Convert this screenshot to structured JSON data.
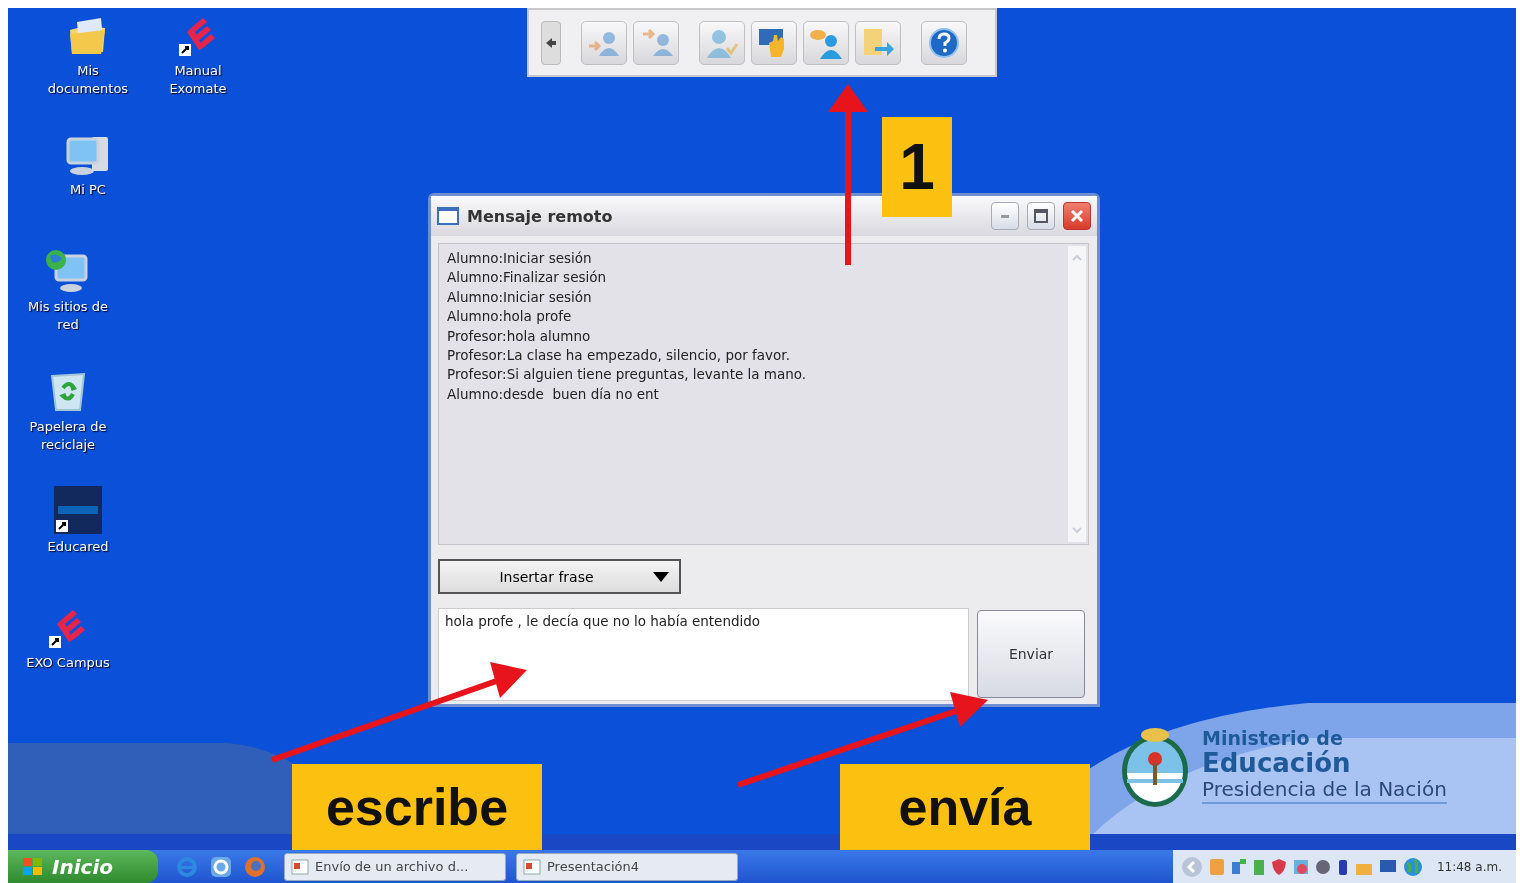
{
  "desktop_icons": [
    {
      "kind": "folder",
      "label": "Mis documentos"
    },
    {
      "kind": "exo",
      "label": "Manual Exomate"
    },
    {
      "kind": "computer",
      "label": "Mi PC"
    },
    {
      "kind": "network",
      "label": "Mis sitios de red"
    },
    {
      "kind": "recycle",
      "label": "Papelera de reciclaje"
    },
    {
      "kind": "educared",
      "label": "Educared"
    },
    {
      "kind": "exo",
      "label": "EXO Campus"
    }
  ],
  "window": {
    "title": "Mensaje remoto",
    "messages": [
      "Alumno:Iniciar sesión",
      "Alumno:Finalizar sesión",
      "Alumno:Iniciar sesión",
      "Alumno:hola profe",
      "Profesor:hola alumno",
      "Profesor:La clase ha empezado, silencio, por favor.",
      "Profesor:Si alguien tiene preguntas, levante la mano.",
      "Alumno:desde  buen día no ent"
    ],
    "phrase_dropdown": "Insertar frase",
    "message_input": "hola profe , le decía que no lo había entendido",
    "send_button": "Enviar"
  },
  "annotations": [
    {
      "kind": "number",
      "text": "1"
    },
    {
      "kind": "write",
      "text": "escribe"
    },
    {
      "kind": "send",
      "text": "envía"
    }
  ],
  "ministry_logo": {
    "line_1": "Ministerio de",
    "line_2": "Educación",
    "line_3": "Presidencia de la Nación"
  },
  "taskbar": {
    "start": "Inicio",
    "tasks": [
      "Envío de un archivo d...",
      "Presentación4"
    ],
    "clock": "11:48 a.m."
  }
}
